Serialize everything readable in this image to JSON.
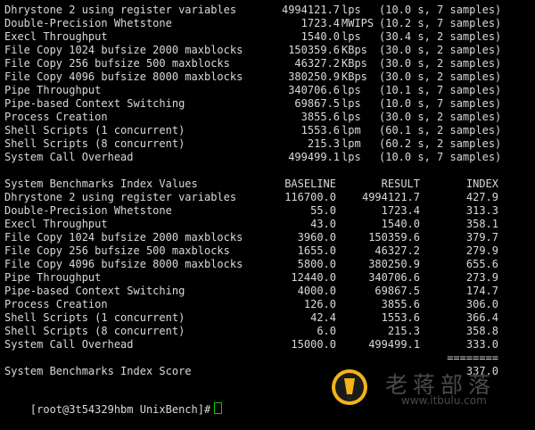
{
  "results": [
    {
      "name": "Dhrystone 2 using register variables",
      "value": "4994121.7",
      "unit": "lps",
      "timing": "(10.0 s, 7 samples)"
    },
    {
      "name": "Double-Precision Whetstone",
      "value": "1723.4",
      "unit": "MWIPS",
      "timing": "(10.2 s, 7 samples)"
    },
    {
      "name": "Execl Throughput",
      "value": "1540.0",
      "unit": "lps",
      "timing": "(30.4 s, 2 samples)"
    },
    {
      "name": "File Copy 1024 bufsize 2000 maxblocks",
      "value": "150359.6",
      "unit": "KBps",
      "timing": "(30.0 s, 2 samples)"
    },
    {
      "name": "File Copy 256 bufsize 500 maxblocks",
      "value": "46327.2",
      "unit": "KBps",
      "timing": "(30.0 s, 2 samples)"
    },
    {
      "name": "File Copy 4096 bufsize 8000 maxblocks",
      "value": "380250.9",
      "unit": "KBps",
      "timing": "(30.0 s, 2 samples)"
    },
    {
      "name": "Pipe Throughput",
      "value": "340706.6",
      "unit": "lps",
      "timing": "(10.1 s, 7 samples)"
    },
    {
      "name": "Pipe-based Context Switching",
      "value": "69867.5",
      "unit": "lps",
      "timing": "(10.0 s, 7 samples)"
    },
    {
      "name": "Process Creation",
      "value": "3855.6",
      "unit": "lps",
      "timing": "(30.0 s, 2 samples)"
    },
    {
      "name": "Shell Scripts (1 concurrent)",
      "value": "1553.6",
      "unit": "lpm",
      "timing": "(60.1 s, 2 samples)"
    },
    {
      "name": "Shell Scripts (8 concurrent)",
      "value": "215.3",
      "unit": "lpm",
      "timing": "(60.2 s, 2 samples)"
    },
    {
      "name": "System Call Overhead",
      "value": "499499.1",
      "unit": "lps",
      "timing": "(10.0 s, 7 samples)"
    }
  ],
  "index_table": {
    "title": "System Benchmarks Index Values",
    "columns": [
      "BASELINE",
      "RESULT",
      "INDEX"
    ],
    "rows": [
      {
        "name": "Dhrystone 2 using register variables",
        "baseline": "116700.0",
        "result": "4994121.7",
        "index": "427.9"
      },
      {
        "name": "Double-Precision Whetstone",
        "baseline": "55.0",
        "result": "1723.4",
        "index": "313.3"
      },
      {
        "name": "Execl Throughput",
        "baseline": "43.0",
        "result": "1540.0",
        "index": "358.1"
      },
      {
        "name": "File Copy 1024 bufsize 2000 maxblocks",
        "baseline": "3960.0",
        "result": "150359.6",
        "index": "379.7"
      },
      {
        "name": "File Copy 256 bufsize 500 maxblocks",
        "baseline": "1655.0",
        "result": "46327.2",
        "index": "279.9"
      },
      {
        "name": "File Copy 4096 bufsize 8000 maxblocks",
        "baseline": "5800.0",
        "result": "380250.9",
        "index": "655.6"
      },
      {
        "name": "Pipe Throughput",
        "baseline": "12440.0",
        "result": "340706.6",
        "index": "273.9"
      },
      {
        "name": "Pipe-based Context Switching",
        "baseline": "4000.0",
        "result": "69867.5",
        "index": "174.7"
      },
      {
        "name": "Process Creation",
        "baseline": "126.0",
        "result": "3855.6",
        "index": "306.0"
      },
      {
        "name": "Shell Scripts (1 concurrent)",
        "baseline": "42.4",
        "result": "1553.6",
        "index": "366.4"
      },
      {
        "name": "Shell Scripts (8 concurrent)",
        "baseline": "6.0",
        "result": "215.3",
        "index": "358.8"
      },
      {
        "name": "System Call Overhead",
        "baseline": "15000.0",
        "result": "499499.1",
        "index": "333.0"
      }
    ],
    "separator": "========",
    "score_label": "System Benchmarks Index Score",
    "score": "337.0"
  },
  "prompt": "[root@3t54329hbm UnixBench]#",
  "watermark": {
    "title": "老蒋部落",
    "url": "www.itbulu.com",
    "icon": "pencil-badge-icon",
    "colors": {
      "badge": "#f2b418",
      "text": "#4a4a4a"
    }
  },
  "colors": {
    "background": "#000000",
    "text": "#d9d9d9",
    "cursor": "#00d000"
  }
}
